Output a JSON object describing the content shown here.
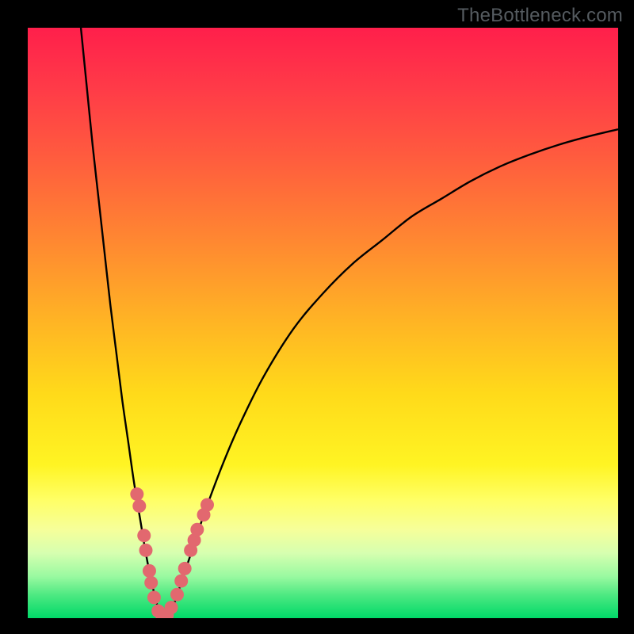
{
  "attribution": "TheBottleneck.com",
  "colors": {
    "frame": "#000000",
    "curve": "#000000",
    "marker": "#e2686f",
    "gradient_stops": [
      {
        "offset": 0.0,
        "color": "#ff1f4b"
      },
      {
        "offset": 0.1,
        "color": "#ff3a48"
      },
      {
        "offset": 0.22,
        "color": "#ff5c3e"
      },
      {
        "offset": 0.35,
        "color": "#ff8432"
      },
      {
        "offset": 0.5,
        "color": "#ffb524"
      },
      {
        "offset": 0.62,
        "color": "#ffda1a"
      },
      {
        "offset": 0.74,
        "color": "#fff423"
      },
      {
        "offset": 0.8,
        "color": "#ffff66"
      },
      {
        "offset": 0.85,
        "color": "#f6ff9a"
      },
      {
        "offset": 0.89,
        "color": "#d6ffb0"
      },
      {
        "offset": 0.93,
        "color": "#98f9a0"
      },
      {
        "offset": 0.96,
        "color": "#4fe982"
      },
      {
        "offset": 1.0,
        "color": "#00d968"
      }
    ]
  },
  "chart_data": {
    "type": "line",
    "title": "",
    "xlabel": "",
    "ylabel": "",
    "xlim": [
      0,
      100
    ],
    "ylim": [
      0,
      100
    ],
    "grid": false,
    "legend": false,
    "series": [
      {
        "name": "bottleneck-curve",
        "x": [
          9,
          10,
          11,
          12,
          13,
          14,
          15,
          16,
          17,
          18,
          19,
          20,
          21,
          22,
          23,
          24,
          25,
          26,
          28,
          30,
          33,
          36,
          40,
          45,
          50,
          55,
          60,
          65,
          70,
          75,
          80,
          85,
          90,
          95,
          100
        ],
        "y": [
          100,
          90,
          80,
          71,
          62,
          53,
          45,
          37,
          30,
          23,
          17,
          11,
          6,
          2,
          0,
          1,
          3,
          6,
          12,
          18,
          26,
          33,
          41,
          49,
          55,
          60,
          64,
          68,
          71,
          74,
          76.5,
          78.5,
          80.2,
          81.6,
          82.8
        ]
      }
    ],
    "markers": [
      {
        "x": 18.5,
        "y": 21
      },
      {
        "x": 18.9,
        "y": 19
      },
      {
        "x": 19.7,
        "y": 14
      },
      {
        "x": 20.0,
        "y": 11.5
      },
      {
        "x": 20.6,
        "y": 8
      },
      {
        "x": 20.9,
        "y": 6
      },
      {
        "x": 21.4,
        "y": 3.5
      },
      {
        "x": 22.1,
        "y": 1.2
      },
      {
        "x": 22.8,
        "y": 0.3
      },
      {
        "x": 23.6,
        "y": 0.5
      },
      {
        "x": 24.3,
        "y": 1.8
      },
      {
        "x": 25.3,
        "y": 4
      },
      {
        "x": 26.0,
        "y": 6.3
      },
      {
        "x": 26.6,
        "y": 8.4
      },
      {
        "x": 27.6,
        "y": 11.5
      },
      {
        "x": 28.2,
        "y": 13.2
      },
      {
        "x": 28.7,
        "y": 15
      },
      {
        "x": 29.8,
        "y": 17.5
      },
      {
        "x": 30.4,
        "y": 19.2
      }
    ]
  }
}
